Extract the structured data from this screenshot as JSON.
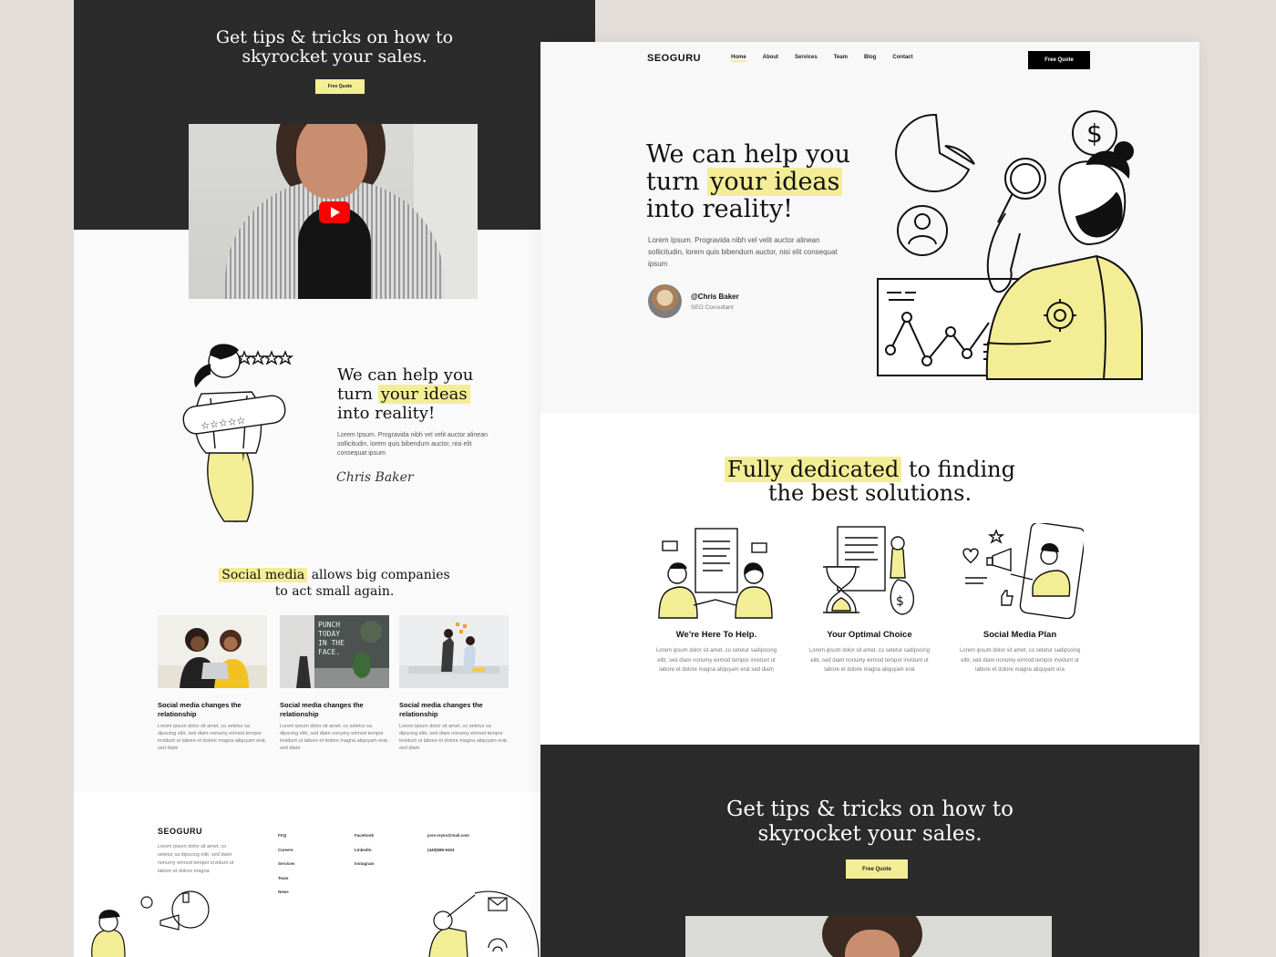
{
  "colors": {
    "accent": "#f3ee96",
    "dark": "#2b2b2b",
    "background": "#e4dedb",
    "youtube": "#ff0000"
  },
  "left": {
    "tips_line1": "Get tips & tricks on how to",
    "tips_line2": "skyrocket your sales.",
    "quote_button": "Free Quote",
    "help": {
      "pre": "We can help you",
      "turn": "turn",
      "hl": "your ideas",
      "post": "into reality!"
    },
    "help_body": "Lorem Ipsum. Progravida nibh vel velit auctor alinean sollicitudin, lorem quis bibendum auctor, nisi elit consequat ipsum",
    "signature": "Chris Baker",
    "social": {
      "hl": "Social media",
      "rest": "allows big companies",
      "line2": "to act small again."
    },
    "cards": [
      {
        "title": "Social media changes the relationship",
        "body": "Lorem ipsum dolor sit amet, co setetur sa dipscing elitr, sed diam nonumy eirmod tempor invidunt ut labore et dolore magna aliquyam erat, sed diam"
      },
      {
        "title": "Social media changes the relationship",
        "body": "Lorem ipsum dolor sit amet, co setetur sa dipscing elitr, sed diam nonumy eirmod tempor invidunt ut labore et dolore magna aliquyam erat, sed diam"
      },
      {
        "title": "Social media changes the relationship",
        "body": "Lorem ipsum dolor sit amet, co setetur sa dipscing elitr, sed diam nonumy eirmod tempor invidunt ut labore et dolore magna aliquyam erat, sed diam"
      }
    ],
    "wall_sign": "PUNCH TODAY IN THE FACE.",
    "footer": {
      "logo": "SEOGURU",
      "text": "Lorem ipsum dolor sit amet, co setetur sa dipscing elitr, sed diam nonumy eirmod tempor invidunt ut labore et dolore magna",
      "col1": [
        "FAQ",
        "Careers",
        "Services",
        "Team",
        "News"
      ],
      "col2": [
        "Facebook",
        "Linkedin",
        "Instagram"
      ],
      "col3": [
        "jose.reyes@mail.com",
        "(449)586-9404"
      ]
    }
  },
  "right": {
    "logo": "SEOGURU",
    "nav": [
      "Home",
      "About",
      "Services",
      "Team",
      "Blog",
      "Contact"
    ],
    "active_nav": "Home",
    "quote_button": "Free Quote",
    "hero": {
      "line1": "We can help you",
      "turn": "turn",
      "hl": "your ideas",
      "line3": "into reality!"
    },
    "hero_body": "Lorem Ipsum. Progravida nibh vel velit auctor alinean sollicitudin, lorem quis bibendum auctor, nisi elit consequat ipsum",
    "author": {
      "name": "@Chris Baker",
      "role": "SEO Consultant"
    },
    "dedicated": {
      "hl": "Fully dedicated",
      "rest": "to finding",
      "line2": "the best solutions."
    },
    "features": [
      {
        "title": "We're Here To Help.",
        "body": "Lorem ipsum dolor sit amet, co setetur sadipscing elitr, sed diam nonumy eirmod tempor invidunt ut labore et dolore magna aliquyam erat sed diam"
      },
      {
        "title": "Your Optimal Choice",
        "body": "Lorem ipsum dolor sit amet, co setetur sadipscing elitr, sed diam nonumy eirmod tempor invidunt ut labore et dolore magna aliquyam erat"
      },
      {
        "title": "Social Media Plan",
        "body": "Lorem ipsum dolor sit amet, co setetur sadipscing elitr, sed diam nonumy eirmod tempor invidunt ut labore et dolore magna aliquyam era"
      }
    ],
    "tips_line1": "Get tips & tricks on how to",
    "tips_line2": "skyrocket your sales.",
    "tips_button": "Free Quote"
  }
}
